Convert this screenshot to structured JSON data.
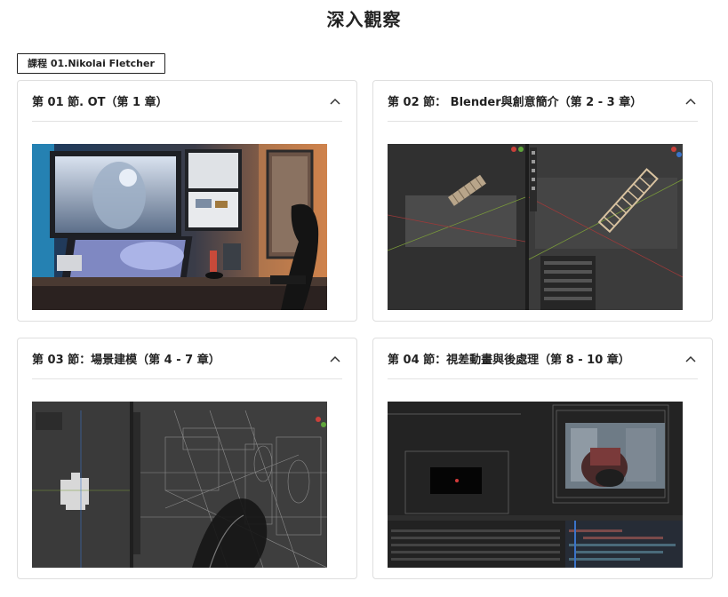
{
  "page": {
    "title": "深入觀察"
  },
  "course": {
    "tag": "課程 01.Nikolai Fletcher"
  },
  "sections": [
    {
      "title": "第 01 節. OT（第 1 章）",
      "toggle_icon": "chevron-up-icon",
      "image": "workstation-photo"
    },
    {
      "title": "第 02 節： Blender與創意簡介（第 2 - 3 章）",
      "toggle_icon": "chevron-up-icon",
      "image": "blender-stairs-screenshot"
    },
    {
      "title": "第 03 節：場景建模（第 4 - 7 章）",
      "toggle_icon": "chevron-up-icon",
      "image": "blender-wireframe-scene-screenshot"
    },
    {
      "title": "第 04 節：視差動畫與後處理（第 8 - 10 章）",
      "toggle_icon": "chevron-up-icon",
      "image": "after-effects-compositing-screenshot"
    }
  ]
}
